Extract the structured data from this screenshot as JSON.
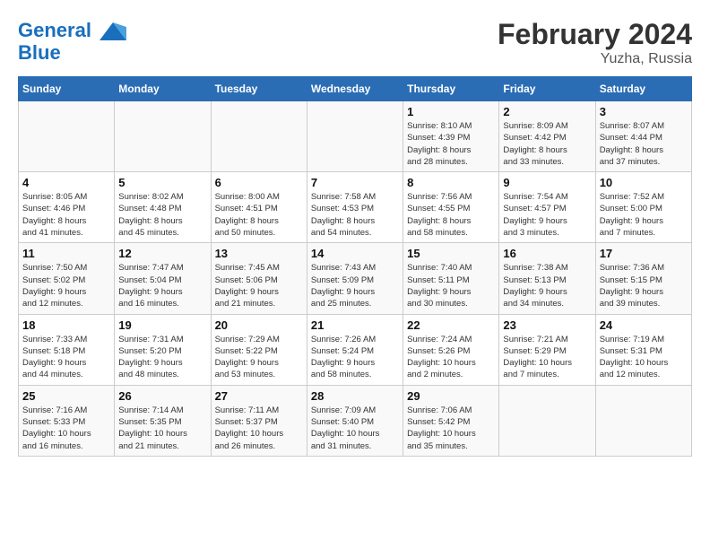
{
  "header": {
    "logo_line1": "General",
    "logo_line2": "Blue",
    "main_title": "February 2024",
    "sub_title": "Yuzha, Russia"
  },
  "days_of_week": [
    "Sunday",
    "Monday",
    "Tuesday",
    "Wednesday",
    "Thursday",
    "Friday",
    "Saturday"
  ],
  "weeks": [
    [
      {
        "day": "",
        "info": ""
      },
      {
        "day": "",
        "info": ""
      },
      {
        "day": "",
        "info": ""
      },
      {
        "day": "",
        "info": ""
      },
      {
        "day": "1",
        "info": "Sunrise: 8:10 AM\nSunset: 4:39 PM\nDaylight: 8 hours\nand 28 minutes."
      },
      {
        "day": "2",
        "info": "Sunrise: 8:09 AM\nSunset: 4:42 PM\nDaylight: 8 hours\nand 33 minutes."
      },
      {
        "day": "3",
        "info": "Sunrise: 8:07 AM\nSunset: 4:44 PM\nDaylight: 8 hours\nand 37 minutes."
      }
    ],
    [
      {
        "day": "4",
        "info": "Sunrise: 8:05 AM\nSunset: 4:46 PM\nDaylight: 8 hours\nand 41 minutes."
      },
      {
        "day": "5",
        "info": "Sunrise: 8:02 AM\nSunset: 4:48 PM\nDaylight: 8 hours\nand 45 minutes."
      },
      {
        "day": "6",
        "info": "Sunrise: 8:00 AM\nSunset: 4:51 PM\nDaylight: 8 hours\nand 50 minutes."
      },
      {
        "day": "7",
        "info": "Sunrise: 7:58 AM\nSunset: 4:53 PM\nDaylight: 8 hours\nand 54 minutes."
      },
      {
        "day": "8",
        "info": "Sunrise: 7:56 AM\nSunset: 4:55 PM\nDaylight: 8 hours\nand 58 minutes."
      },
      {
        "day": "9",
        "info": "Sunrise: 7:54 AM\nSunset: 4:57 PM\nDaylight: 9 hours\nand 3 minutes."
      },
      {
        "day": "10",
        "info": "Sunrise: 7:52 AM\nSunset: 5:00 PM\nDaylight: 9 hours\nand 7 minutes."
      }
    ],
    [
      {
        "day": "11",
        "info": "Sunrise: 7:50 AM\nSunset: 5:02 PM\nDaylight: 9 hours\nand 12 minutes."
      },
      {
        "day": "12",
        "info": "Sunrise: 7:47 AM\nSunset: 5:04 PM\nDaylight: 9 hours\nand 16 minutes."
      },
      {
        "day": "13",
        "info": "Sunrise: 7:45 AM\nSunset: 5:06 PM\nDaylight: 9 hours\nand 21 minutes."
      },
      {
        "day": "14",
        "info": "Sunrise: 7:43 AM\nSunset: 5:09 PM\nDaylight: 9 hours\nand 25 minutes."
      },
      {
        "day": "15",
        "info": "Sunrise: 7:40 AM\nSunset: 5:11 PM\nDaylight: 9 hours\nand 30 minutes."
      },
      {
        "day": "16",
        "info": "Sunrise: 7:38 AM\nSunset: 5:13 PM\nDaylight: 9 hours\nand 34 minutes."
      },
      {
        "day": "17",
        "info": "Sunrise: 7:36 AM\nSunset: 5:15 PM\nDaylight: 9 hours\nand 39 minutes."
      }
    ],
    [
      {
        "day": "18",
        "info": "Sunrise: 7:33 AM\nSunset: 5:18 PM\nDaylight: 9 hours\nand 44 minutes."
      },
      {
        "day": "19",
        "info": "Sunrise: 7:31 AM\nSunset: 5:20 PM\nDaylight: 9 hours\nand 48 minutes."
      },
      {
        "day": "20",
        "info": "Sunrise: 7:29 AM\nSunset: 5:22 PM\nDaylight: 9 hours\nand 53 minutes."
      },
      {
        "day": "21",
        "info": "Sunrise: 7:26 AM\nSunset: 5:24 PM\nDaylight: 9 hours\nand 58 minutes."
      },
      {
        "day": "22",
        "info": "Sunrise: 7:24 AM\nSunset: 5:26 PM\nDaylight: 10 hours\nand 2 minutes."
      },
      {
        "day": "23",
        "info": "Sunrise: 7:21 AM\nSunset: 5:29 PM\nDaylight: 10 hours\nand 7 minutes."
      },
      {
        "day": "24",
        "info": "Sunrise: 7:19 AM\nSunset: 5:31 PM\nDaylight: 10 hours\nand 12 minutes."
      }
    ],
    [
      {
        "day": "25",
        "info": "Sunrise: 7:16 AM\nSunset: 5:33 PM\nDaylight: 10 hours\nand 16 minutes."
      },
      {
        "day": "26",
        "info": "Sunrise: 7:14 AM\nSunset: 5:35 PM\nDaylight: 10 hours\nand 21 minutes."
      },
      {
        "day": "27",
        "info": "Sunrise: 7:11 AM\nSunset: 5:37 PM\nDaylight: 10 hours\nand 26 minutes."
      },
      {
        "day": "28",
        "info": "Sunrise: 7:09 AM\nSunset: 5:40 PM\nDaylight: 10 hours\nand 31 minutes."
      },
      {
        "day": "29",
        "info": "Sunrise: 7:06 AM\nSunset: 5:42 PM\nDaylight: 10 hours\nand 35 minutes."
      },
      {
        "day": "",
        "info": ""
      },
      {
        "day": "",
        "info": ""
      }
    ]
  ]
}
